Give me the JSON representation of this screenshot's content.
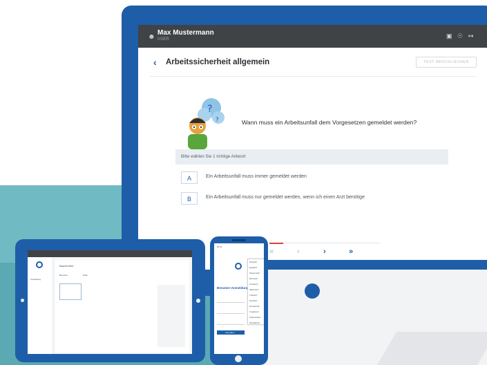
{
  "header": {
    "user_name": "Max Mustermann",
    "user_role": "USER"
  },
  "page": {
    "title": "Arbeitssicherheit allgemein",
    "close_test_label": "TEST ABSCHLIESSEN"
  },
  "quiz": {
    "question": "Wann muss ein Arbeitsunfall dem Vorgesetzen gemeldet werden?",
    "hint": "Bitte wählen Sie 1 richtige Antwort",
    "answers": [
      {
        "letter": "A",
        "text": "Ein Arbeitsunfall muss immer gemeldet werden"
      },
      {
        "letter": "B",
        "text": "Ein Arbeitsunfall muss nur gemeldet werden, wenn ich einen Arzt benötige"
      }
    ]
  },
  "navigation": {
    "first": "«",
    "prev": "‹",
    "next": "›",
    "last": "»"
  },
  "tablet": {
    "title": "Bauvertrieb",
    "label_1": "Benutzer",
    "label_2": "Rolle",
    "section": "Verwaltung"
  },
  "phone": {
    "time": "09:41",
    "heading": "Benutzer-Anmeldung",
    "languages": [
      "Deutsch",
      "Englisch",
      "Slowenisch",
      "Bosnisch",
      "Kroatisch",
      "Italienisch",
      "Türkisch",
      "Polnisch",
      "Rumänisch",
      "Ungarisch",
      "Tschechisch",
      "Slowakisch"
    ],
    "login_label": "Anmelden"
  },
  "colors": {
    "brand": "#1e5ea8",
    "topbar": "#3f4346",
    "accent_red": "#d6423b",
    "teal": "#6fbac3"
  }
}
